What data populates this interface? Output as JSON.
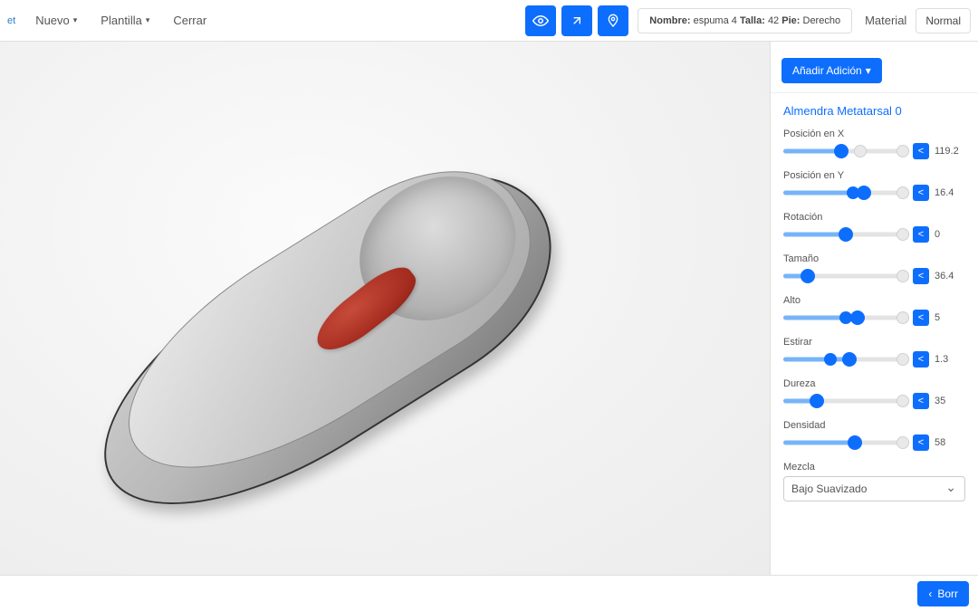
{
  "brand": "et",
  "menu": {
    "nuevo": "Nuevo",
    "plantilla": "Plantilla",
    "cerrar": "Cerrar"
  },
  "toolbar": {
    "visibility_icon": "eye-icon",
    "expand_icon": "expand-icon",
    "marker_icon": "map-pin-icon"
  },
  "info": {
    "nombre_label": "Nombre:",
    "nombre_value": "espuma 4",
    "talla_label": "Talla:",
    "talla_value": "42",
    "pie_label": "Pie:",
    "pie_value": "Derecho"
  },
  "right": {
    "material": "Material",
    "normal": "Normal"
  },
  "add_button": "Añadir Adición",
  "panel_title": "Almendra Metatarsal 0",
  "controls": {
    "posx": {
      "label": "Posición en X",
      "value": "119.2",
      "fill": 44,
      "thumb": 47
    },
    "posy": {
      "label": "Posición en Y",
      "value": "16.4",
      "fill": 64,
      "thumb": 65
    },
    "rot": {
      "label": "Rotación",
      "value": "0",
      "fill": 48,
      "thumb": 50
    },
    "tam": {
      "label": "Tamaño",
      "value": "36.4",
      "fill": 18,
      "thumb": 20
    },
    "alto": {
      "label": "Alto",
      "value": "5",
      "fill": 58,
      "thumb": 60
    },
    "estirar": {
      "label": "Estirar",
      "value": "1.3",
      "fill": 52,
      "thumb": 53
    },
    "dureza": {
      "label": "Dureza",
      "value": "35",
      "fill": 25,
      "thumb": 27
    },
    "dens": {
      "label": "Densidad",
      "value": "58",
      "fill": 55,
      "thumb": 58
    }
  },
  "mezcla": {
    "label": "Mezcla",
    "value": "Bajo Suavizado"
  },
  "delete_button": "Borr",
  "toggle_symbol": "<"
}
